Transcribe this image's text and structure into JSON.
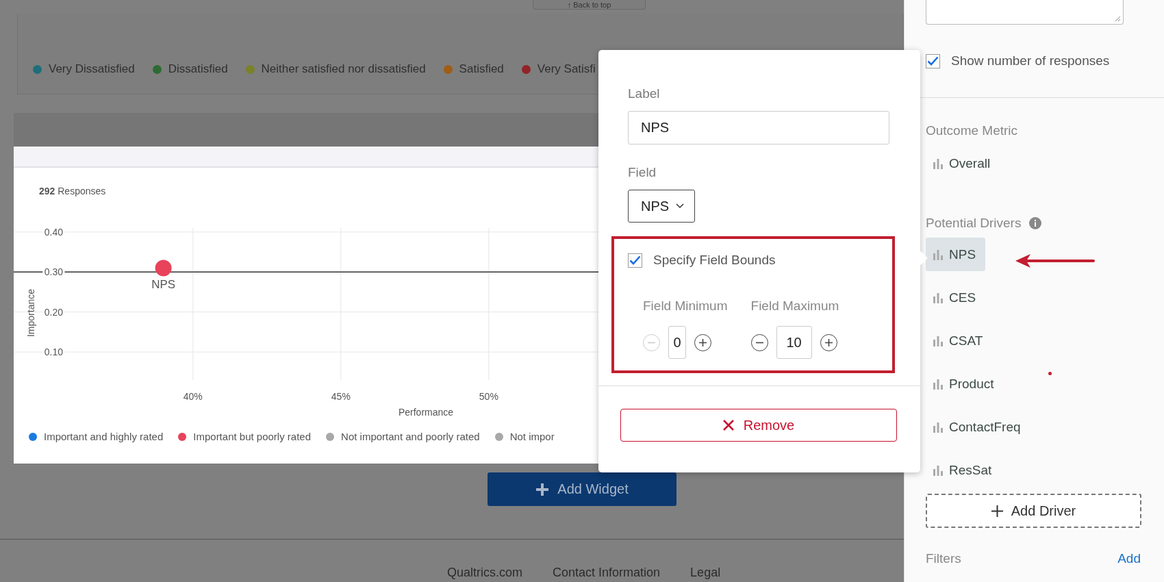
{
  "back_to_top": {
    "label": "↑ Back to top"
  },
  "satisfaction_legend": [
    {
      "label": "Very Dissatisfied",
      "color": "#1d6f7b"
    },
    {
      "label": "Dissatisfied",
      "color": "#2e6b33"
    },
    {
      "label": "Neither satisfied nor dissatisfied",
      "color": "#7a8228"
    },
    {
      "label": "Satisfied",
      "color": "#a05d15"
    },
    {
      "label": "Very Satisfi",
      "color": "#922328"
    }
  ],
  "widget": {
    "responses": "**292** Responses",
    "chart_data": {
      "type": "scatter",
      "xlabel": "Performance",
      "ylabel": "Importance",
      "x": [
        39.0
      ],
      "series": [
        {
          "name": "NPS",
          "color": "#e8435a",
          "values": [
            0.31
          ]
        }
      ],
      "xlim": [
        33.94,
        53.73
      ],
      "ylim": [
        0.03,
        0.41
      ],
      "xticks": [
        {
          "value": 40,
          "label": "40%"
        },
        {
          "value": 45,
          "label": "45%"
        },
        {
          "value": 50,
          "label": "50%"
        }
      ],
      "yticks": [
        {
          "value": 0.1,
          "label": "0.10"
        },
        {
          "value": 0.2,
          "label": "0.20"
        },
        {
          "value": 0.3,
          "label": "0.30"
        },
        {
          "value": 0.4,
          "label": "0.40"
        }
      ],
      "grid": true,
      "ref_lines": [
        {
          "axis": "y",
          "value": 0.3
        }
      ]
    },
    "legend": [
      {
        "label": "Important and highly rated",
        "color": "#1a7be0"
      },
      {
        "label": "Important but poorly rated",
        "color": "#e8435a"
      },
      {
        "label": "Not important and poorly rated",
        "color": "#a8a8a8"
      },
      {
        "label": "Not impor",
        "color": "#a8a8a8"
      }
    ]
  },
  "add_widget": {
    "label": "Add Widget"
  },
  "footer": [
    "Qualtrics.com",
    "Contact Information",
    "Legal"
  ],
  "popup": {
    "label_field": {
      "label": "Label",
      "value": "NPS"
    },
    "field": {
      "label": "Field",
      "value": "NPS"
    },
    "bounds": {
      "label": "Specify Field Bounds",
      "checked": true,
      "minimum": {
        "label": "Field Minimum",
        "value": "0",
        "decrement_disabled": true
      },
      "maximum": {
        "label": "Field Maximum",
        "value": "10",
        "decrement_disabled": false
      }
    },
    "remove": {
      "label": "Remove"
    }
  },
  "sidebar": {
    "show_responses": {
      "label": "Show number of responses",
      "checked": true
    },
    "outcome_metric": {
      "title": "Outcome Metric",
      "items": [
        {
          "label": "Overall"
        }
      ]
    },
    "potential_drivers": {
      "title": "Potential Drivers",
      "items": [
        {
          "label": "NPS",
          "selected": true
        },
        {
          "label": "CES",
          "selected": false
        },
        {
          "label": "CSAT",
          "selected": false
        },
        {
          "label": "Product",
          "selected": false
        },
        {
          "label": "ContactFreq",
          "selected": false
        },
        {
          "label": "ResSat",
          "selected": false
        }
      ]
    },
    "add_driver": {
      "label": "Add Driver"
    },
    "filters": {
      "title": "Filters",
      "action": "Add"
    }
  }
}
